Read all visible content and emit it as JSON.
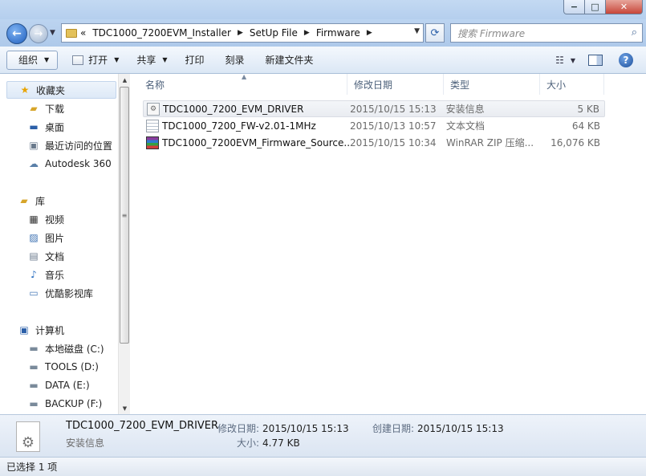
{
  "titlebar": {
    "minimize": "−",
    "maximize": "□",
    "close": "✕"
  },
  "nav": {
    "back_icon": "←",
    "forward_icon": "→",
    "breadcrumb": [
      "TDC1000_7200EVM_Installer",
      "SetUp File",
      "Firmware"
    ],
    "overflow_chevron": "«",
    "search_placeholder": "搜索 Firmware"
  },
  "toolbar": {
    "organize": "组织",
    "open": "打开",
    "share": "共享",
    "print": "打印",
    "burn": "刻录",
    "new_folder": "新建文件夹"
  },
  "sidebar": {
    "favorites": {
      "label": "收藏夹",
      "items": [
        "下载",
        "桌面",
        "最近访问的位置",
        "Autodesk 360"
      ]
    },
    "libraries": {
      "label": "库",
      "items": [
        "视频",
        "图片",
        "文档",
        "音乐",
        "优酷影视库"
      ]
    },
    "computer": {
      "label": "计算机",
      "items": [
        "本地磁盘 (C:)",
        "TOOLS (D:)",
        "DATA (E:)",
        "BACKUP (F:)"
      ]
    }
  },
  "columns": {
    "name": "名称",
    "date": "修改日期",
    "type": "类型",
    "size": "大小"
  },
  "files": [
    {
      "name": "TDC1000_7200_EVM_DRIVER",
      "date": "2015/10/15 15:13",
      "type": "安装信息",
      "size": "5 KB",
      "icon": "setup-info-icon"
    },
    {
      "name": "TDC1000_7200_FW-v2.01-1MHz",
      "date": "2015/10/13 10:57",
      "type": "文本文档",
      "size": "64 KB",
      "icon": "text-document-icon"
    },
    {
      "name": "TDC1000_7200EVM_Firmware_Source...",
      "date": "2015/10/15 10:34",
      "type": "WinRAR ZIP 压缩...",
      "size": "16,076 KB",
      "icon": "winrar-archive-icon"
    }
  ],
  "details": {
    "name": "TDC1000_7200_EVM_DRIVER",
    "type": "安装信息",
    "modified_label": "修改日期:",
    "modified": "2015/10/15 15:13",
    "created_label": "创建日期:",
    "created": "2015/10/15 15:13",
    "size_label": "大小:",
    "size": "4.77 KB"
  },
  "status": {
    "text": "已选择 1 项"
  }
}
